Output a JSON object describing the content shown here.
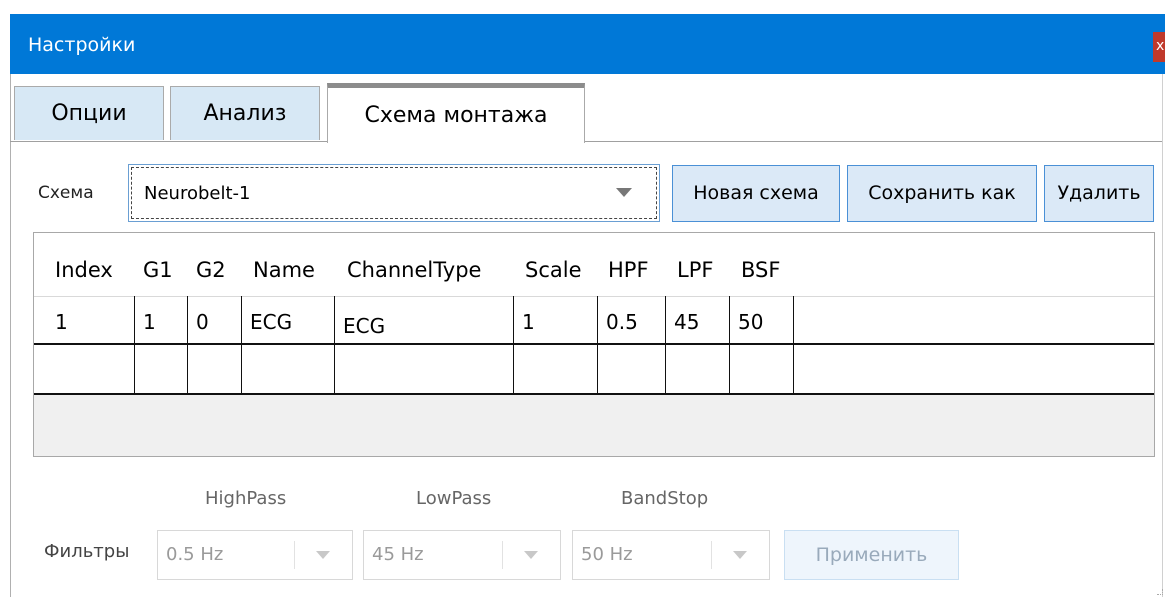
{
  "window": {
    "title": "Настройки",
    "close_label": "x"
  },
  "tabs": [
    {
      "label": "Опции",
      "active": false
    },
    {
      "label": "Анализ",
      "active": false
    },
    {
      "label": "Схема монтажа",
      "active": true
    }
  ],
  "scheme": {
    "label": "Схема",
    "selected": "Neurobelt-1",
    "new_button": "Новая схема",
    "save_as_button": "Сохранить как",
    "delete_button": "Удалить"
  },
  "grid": {
    "columns": [
      "Index",
      "G1",
      "G2",
      "Name",
      "ChannelType",
      "Scale",
      "HPF",
      "LPF",
      "BSF"
    ],
    "rows": [
      [
        "1",
        "1",
        "0",
        "ECG",
        "ECG",
        "1",
        "0.5",
        "45",
        "50"
      ],
      [
        "",
        "",
        "",
        "",
        "",
        "",
        "",
        "",
        ""
      ]
    ]
  },
  "filters": {
    "label": "Фильтры",
    "highpass_label": "HighPass",
    "lowpass_label": "LowPass",
    "bandstop_label": "BandStop",
    "highpass_value": "0.5 Hz",
    "lowpass_value": "45 Hz",
    "bandstop_value": "50 Hz",
    "apply_button": "Применить"
  },
  "colors": {
    "titlebar": "#0078d7",
    "tab_inactive": "#d7e8f5",
    "button": "#dbe9f7",
    "close": "#c0392b"
  }
}
